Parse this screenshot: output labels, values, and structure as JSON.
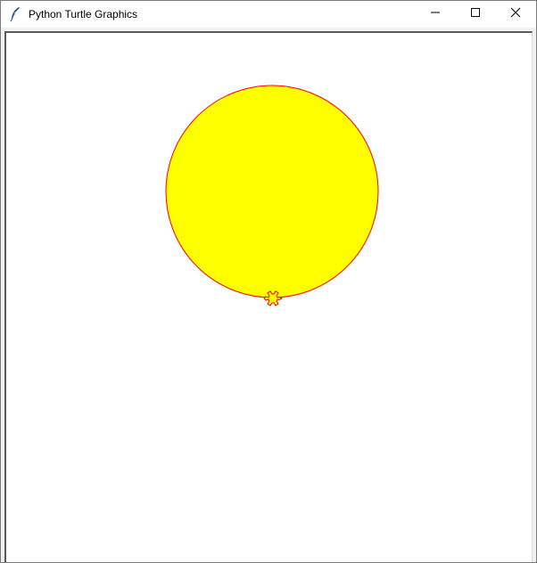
{
  "window": {
    "title": "Python Turtle Graphics",
    "controls": {
      "minimize": "minimize-icon",
      "maximize": "maximize-icon",
      "close": "close-icon"
    }
  },
  "canvas": {
    "background": "#ffffff",
    "circle": {
      "fill": "#ffff00",
      "outline": "#ff0000"
    },
    "turtle": {
      "shape": "turtle",
      "fill": "#ffff00",
      "outline": "#ff0000"
    }
  }
}
